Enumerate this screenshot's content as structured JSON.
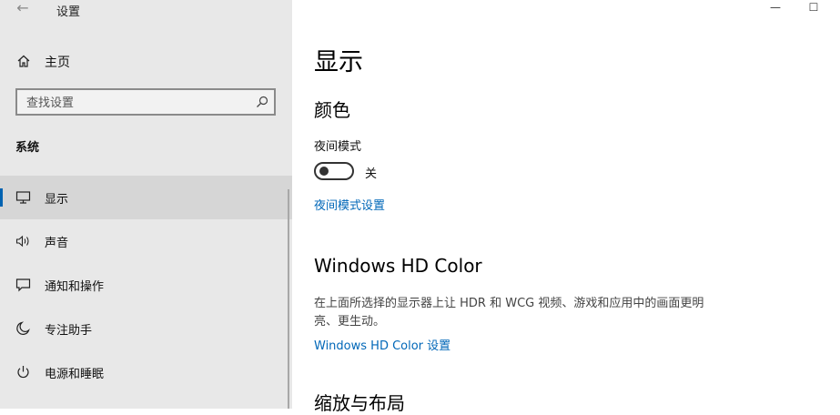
{
  "titlebar": {
    "app_title": "设置",
    "back_icon": "back-arrow-icon"
  },
  "sidebar": {
    "home_label": "主页",
    "search": {
      "placeholder": "查找设置"
    },
    "section_label": "系统",
    "items": [
      {
        "label": "显示",
        "icon": "monitor-icon",
        "active": true
      },
      {
        "label": "声音",
        "icon": "speaker-icon"
      },
      {
        "label": "通知和操作",
        "icon": "notification-icon"
      },
      {
        "label": "专注助手",
        "icon": "moon-icon"
      },
      {
        "label": "电源和睡眠",
        "icon": "power-icon"
      }
    ]
  },
  "window_controls": {
    "minimize": "—",
    "maximize": "☐"
  },
  "main": {
    "title": "显示",
    "color_section": {
      "heading": "颜色",
      "night_light_label": "夜间模式",
      "night_light_state": "关",
      "night_light_link": "夜间模式设置"
    },
    "hd_color_section": {
      "heading": "Windows HD Color",
      "description": "在上面所选择的显示器上让 HDR 和 WCG 视频、游戏和应用中的画面更明亮、更生动。",
      "link": "Windows HD Color 设置"
    },
    "scale_section": {
      "heading": "缩放与布局"
    }
  },
  "colors": {
    "accent": "#0067b8",
    "sidebar_bg": "#e8e8e8",
    "active_item_bg": "#d6d6d6"
  }
}
